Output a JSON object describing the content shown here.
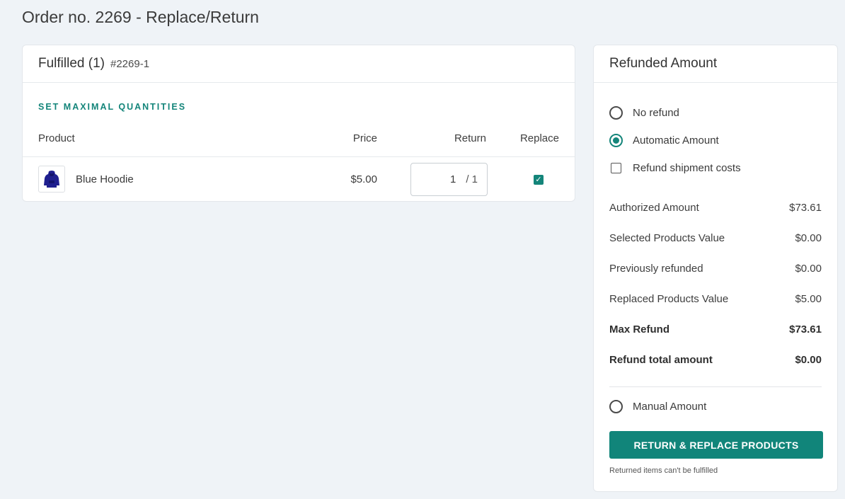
{
  "page": {
    "title": "Order no. 2269 - Replace/Return"
  },
  "fulfilled": {
    "title": "Fulfilled (1)",
    "fulfillment_id": "#2269-1",
    "set_max_label": "SET MAXIMAL QUANTITIES",
    "columns": {
      "product": "Product",
      "price": "Price",
      "return": "Return",
      "replace": "Replace"
    },
    "items": [
      {
        "name": "Blue Hoodie",
        "price": "$5.00",
        "return_qty": "1",
        "return_max": "/ 1",
        "replace_checked": true,
        "thumb_icon": "hoodie-icon"
      }
    ]
  },
  "refund": {
    "title": "Refunded Amount",
    "options": {
      "no_refund": "No refund",
      "automatic": "Automatic Amount",
      "shipment": "Refund shipment costs",
      "manual": "Manual Amount"
    },
    "selected_option": "automatic",
    "summary": [
      {
        "label": "Authorized Amount",
        "value": "$73.61"
      },
      {
        "label": "Selected Products Value",
        "value": "$0.00"
      },
      {
        "label": "Previously refunded",
        "value": "$0.00"
      },
      {
        "label": "Replaced Products Value",
        "value": "$5.00"
      },
      {
        "label": "Max Refund",
        "value": "$73.61"
      },
      {
        "label": "Refund total amount",
        "value": "$0.00"
      }
    ],
    "button_label": "RETURN & REPLACE PRODUCTS",
    "note": "Returned items can't be fulfilled"
  },
  "colors": {
    "accent": "#14857a",
    "background": "#eff3f7"
  }
}
